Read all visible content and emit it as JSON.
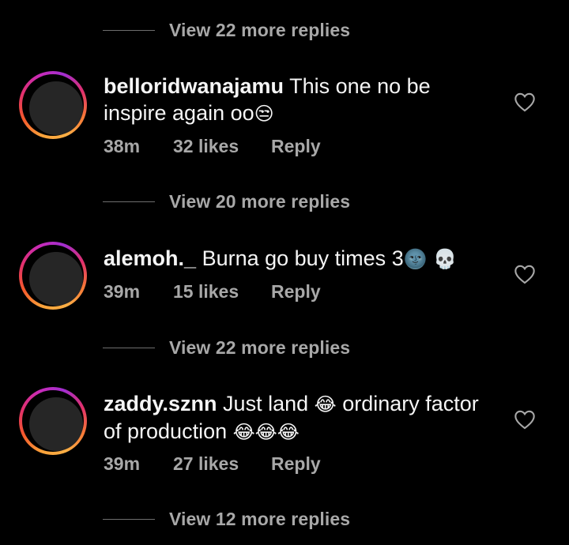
{
  "threads": {
    "top_view_replies": "View 22 more replies",
    "comments": [
      {
        "username": "belloridwanajamu",
        "text": "This one no be inspire again oo",
        "emoji": "😒",
        "time": "38m",
        "likes": "32 likes",
        "reply_label": "Reply",
        "view_replies": "View 20 more replies"
      },
      {
        "username": "alemoh._",
        "text": "Burna go buy times 3",
        "emoji": "🌚 💀",
        "time": "39m",
        "likes": "15 likes",
        "reply_label": "Reply",
        "view_replies": "View 22 more replies"
      },
      {
        "username": "zaddy.sznn",
        "text_a": "Just land",
        "emoji_a": "😂",
        "text_b": "ordinary factor of production",
        "emoji_b": "😂😂😂",
        "time": "39m",
        "likes": "27 likes",
        "reply_label": "Reply",
        "view_replies": "View 12 more replies"
      }
    ]
  },
  "icons": {
    "like": "heart-outline-icon",
    "avatar": "story-ring-avatar"
  },
  "colors": {
    "background": "#000000",
    "text": "#f5f5f5",
    "muted": "#a8a8a8"
  }
}
